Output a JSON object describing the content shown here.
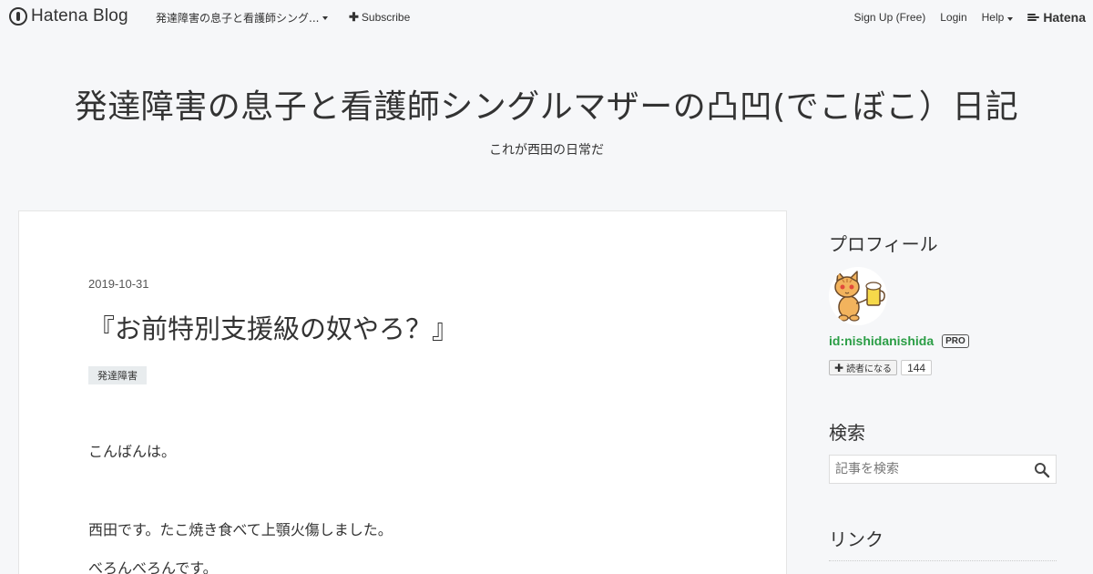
{
  "header": {
    "brand": "Hatena Blog",
    "blog_menu_label": "発達障害の息子と看護師シング...",
    "subscribe_label": "Subscribe",
    "signup_label": "Sign Up (Free)",
    "login_label": "Login",
    "help_label": "Help",
    "hatena_label": "Hatena"
  },
  "blog": {
    "title": "発達障害の息子と看護師シングルマザーの凸凹(でこぼこ）日記",
    "description": "これが西田の日常だ"
  },
  "entry": {
    "date": "2019-10-31",
    "title": "『お前特別支援級の奴やろ？』",
    "category": "発達障害",
    "paragraphs": [
      "こんばんは。",
      "西田です。たこ焼き食べて上顎火傷しました。",
      "べろんべろんです。"
    ]
  },
  "sidebar": {
    "profile": {
      "heading": "プロフィール",
      "user_id": "id:nishidanishida",
      "badge": "PRO",
      "reader_button": "読者になる",
      "reader_count": "144"
    },
    "search": {
      "heading": "検索",
      "placeholder": "記事を検索"
    },
    "links": {
      "heading": "リンク"
    }
  },
  "colors": {
    "background": "#f6f7f9",
    "user_link": "#2a9d45"
  }
}
